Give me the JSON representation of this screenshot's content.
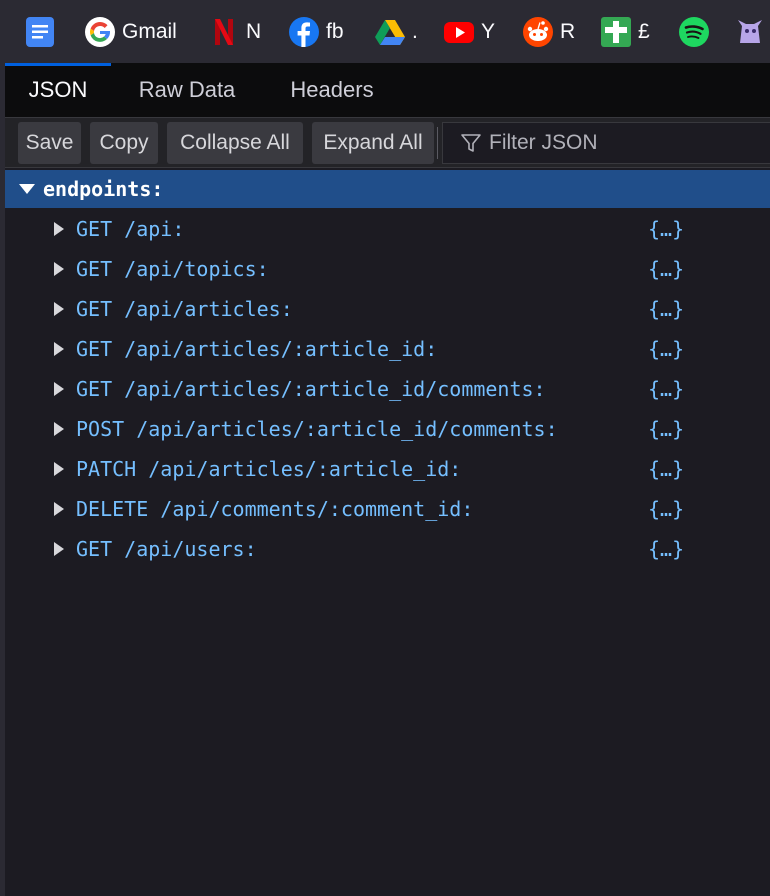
{
  "bookmarks": [
    {
      "icon": "google-docs-icon",
      "label": ""
    },
    {
      "icon": "google-icon",
      "label": "Gmail"
    },
    {
      "icon": "netflix-icon",
      "label": "N"
    },
    {
      "icon": "facebook-icon",
      "label": "fb"
    },
    {
      "icon": "google-drive-icon",
      "label": "."
    },
    {
      "icon": "youtube-icon",
      "label": "Y"
    },
    {
      "icon": "reddit-icon",
      "label": "R"
    },
    {
      "icon": "plus-sign-icon",
      "label": "£"
    },
    {
      "icon": "spotify-icon",
      "label": ""
    },
    {
      "icon": "purple-creature-icon",
      "label": ""
    }
  ],
  "tabs": [
    "JSON",
    "Raw Data",
    "Headers"
  ],
  "toolbar": {
    "save": "Save",
    "copy": "Copy",
    "collapse_all": "Collapse All",
    "expand_all": "Expand All",
    "filter_placeholder": "Filter JSON"
  },
  "tree": {
    "root_key": "endpoints:",
    "rows": [
      {
        "key": "GET /api:",
        "value": "{…}"
      },
      {
        "key": "GET /api/topics:",
        "value": "{…}"
      },
      {
        "key": "GET /api/articles:",
        "value": "{…}"
      },
      {
        "key": "GET /api/articles/:article_id:",
        "value": "{…}"
      },
      {
        "key": "GET /api/articles/:article_id/comments:",
        "value": "{…}"
      },
      {
        "key": "POST /api/articles/:article_id/comments:",
        "value": "{…}"
      },
      {
        "key": "PATCH /api/articles/:article_id:",
        "value": "{…}"
      },
      {
        "key": "DELETE /api/comments/:comment_id:",
        "value": "{…}"
      },
      {
        "key": "GET /api/users:",
        "value": "{…}"
      }
    ]
  },
  "colors": {
    "selected_row": "#204e8a",
    "key_text": "#75bfff",
    "tab_accent": "#0060df"
  }
}
